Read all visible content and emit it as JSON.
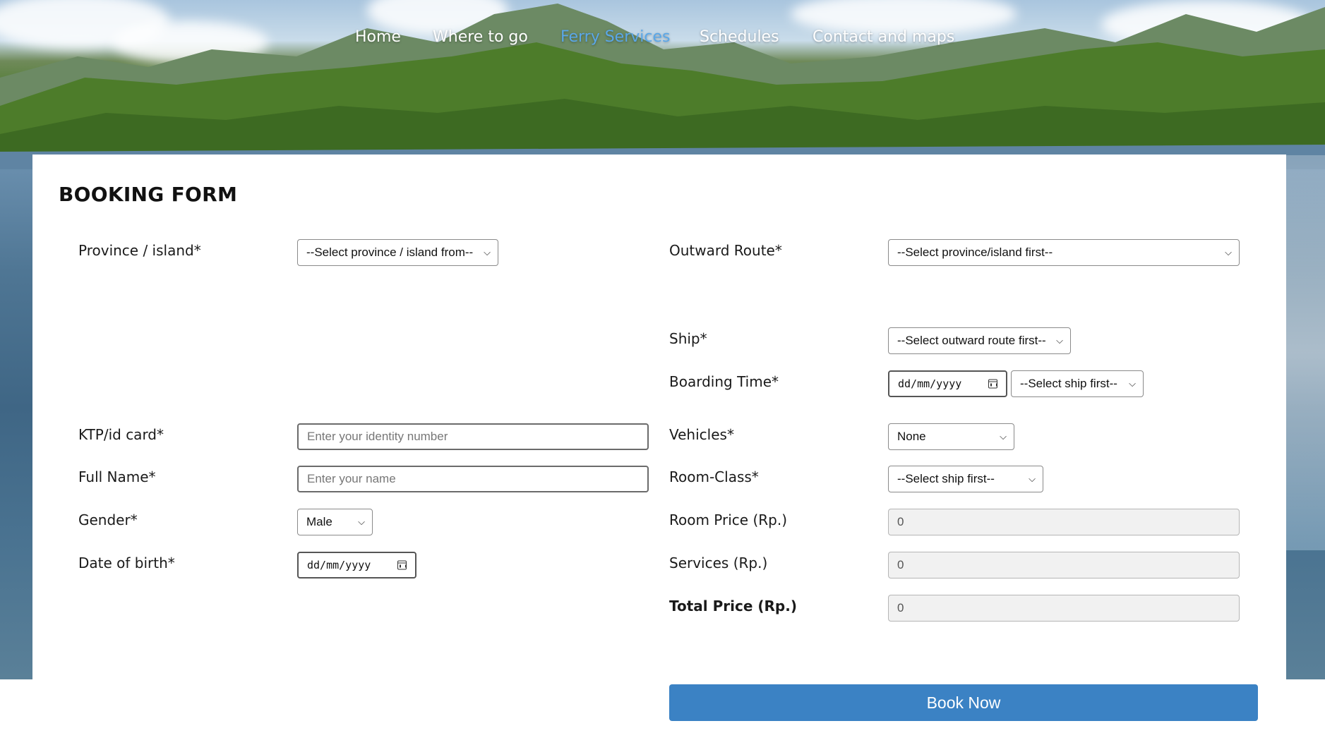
{
  "nav": {
    "items": [
      "Home",
      "Where to go",
      "Ferry Services",
      "Schedules",
      "Contact and maps"
    ],
    "active": "Ferry Services",
    "active_color": "#5aa7e8"
  },
  "form": {
    "title": "BOOKING FORM",
    "province": {
      "label": "Province / island*",
      "value": "--Select province / island from--"
    },
    "outward_route": {
      "label": "Outward Route*",
      "value": "--Select province/island first--"
    },
    "ship": {
      "label": "Ship*",
      "value": "--Select outward route first--"
    },
    "boarding_time": {
      "label": "Boarding Time*",
      "date_placeholder": "dd/mm/yyyy",
      "time_value": "--Select ship first--"
    },
    "ktp": {
      "label": "KTP/id card*",
      "placeholder": "Enter your identity number"
    },
    "full_name": {
      "label": "Full Name*",
      "placeholder": "Enter your name"
    },
    "gender": {
      "label": "Gender*",
      "value": "Male"
    },
    "dob": {
      "label": "Date of birth*",
      "placeholder": "dd/mm/yyyy"
    },
    "vehicles": {
      "label": "Vehicles*",
      "value": "None"
    },
    "room_class": {
      "label": "Room-Class*",
      "value": "--Select ship first--"
    },
    "room_price": {
      "label": "Room Price (Rp.)",
      "value": "0"
    },
    "services": {
      "label": "Services (Rp.)",
      "value": "0"
    },
    "total_price": {
      "label": "Total Price (Rp.)",
      "value": "0"
    },
    "submit_label": "Book Now",
    "submit_color": "#3b82c4"
  }
}
